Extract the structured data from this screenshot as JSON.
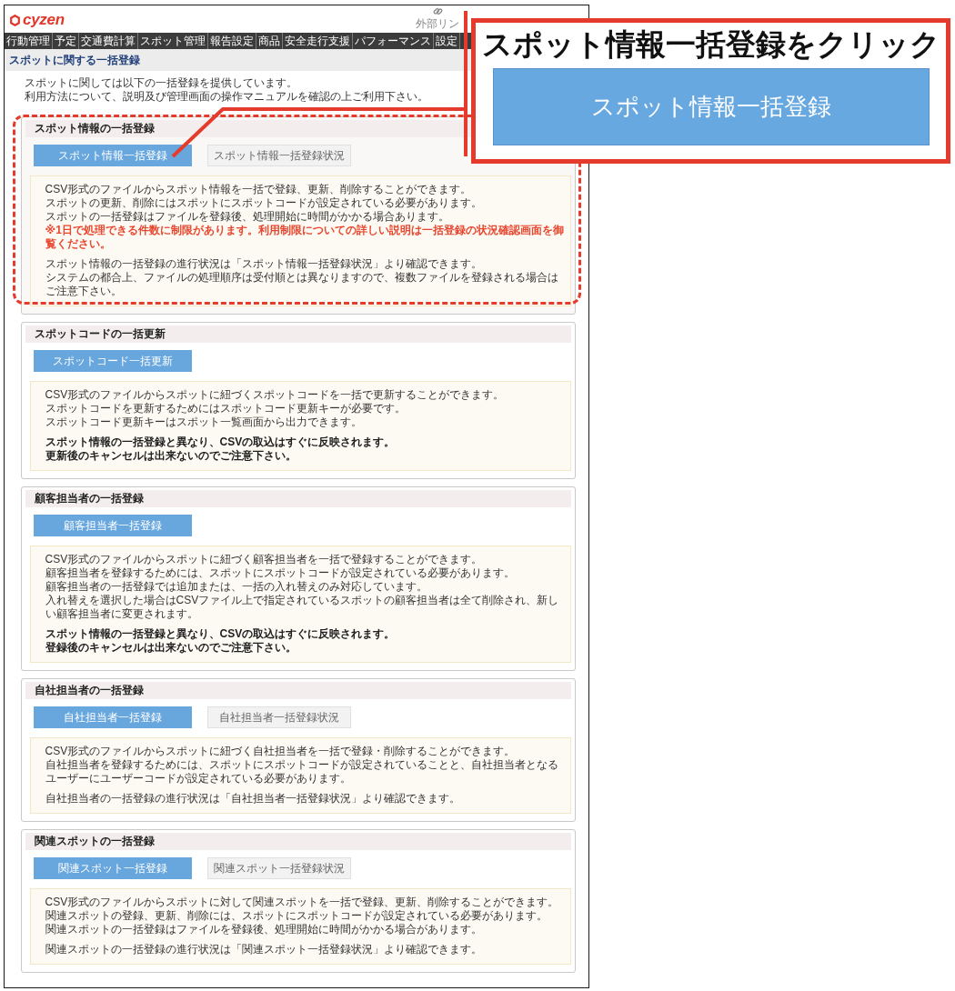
{
  "header": {
    "logo": "cyzen",
    "external_link": "外部リン"
  },
  "nav": [
    {
      "label": "行動管理"
    },
    {
      "label": "予定"
    },
    {
      "label": "交通費計算"
    },
    {
      "label": "スポット管理"
    },
    {
      "label": "報告設定"
    },
    {
      "label": "商品"
    },
    {
      "label": "安全走行支援"
    },
    {
      "label": "パフォーマンス"
    },
    {
      "label": "設定"
    }
  ],
  "page_title": "スポットに関する一括登録",
  "intro": [
    "スポットに関しては以下の一括登録を提供しています。",
    "利用方法について、説明及び管理画面の操作マニュアルを確認の上ご利用下さい。"
  ],
  "sections": [
    {
      "title": "スポット情報の一括登録",
      "highlighted": true,
      "buttons": [
        {
          "label": "スポット情報一括登録",
          "kind": "primary"
        },
        {
          "label": "スポット情報一括登録状況",
          "kind": "secondary"
        }
      ],
      "paragraphs": [
        {
          "lines": [
            {
              "text": "CSV形式のファイルからスポット情報を一括で登録、更新、削除することができます。",
              "kind": "normal"
            },
            {
              "text": "スポットの更新、削除にはスポットにスポットコードが設定されている必要があります。",
              "kind": "normal"
            },
            {
              "text": "スポットの一括登録はファイルを登録後、処理開始に時間がかかる場合あります。",
              "kind": "normal"
            },
            {
              "text": "※1日で処理できる件数に制限があります。利用制限についての詳しい説明は一括登録の状況確認画面を御覧ください。",
              "kind": "warning"
            }
          ]
        },
        {
          "lines": [
            {
              "text": "スポット情報の一括登録の進行状況は「スポット情報一括登録状況」より確認できます。",
              "kind": "normal"
            },
            {
              "text": "システムの都合上、ファイルの処理順序は受付順とは異なりますので、複数ファイルを登録される場合はご注意下さい。",
              "kind": "normal"
            }
          ]
        }
      ]
    },
    {
      "title": "スポットコードの一括更新",
      "highlighted": false,
      "buttons": [
        {
          "label": "スポットコード一括更新",
          "kind": "primary"
        }
      ],
      "paragraphs": [
        {
          "lines": [
            {
              "text": "CSV形式のファイルからスポットに紐づくスポットコードを一括で更新することができます。",
              "kind": "normal"
            },
            {
              "text": "スポットコードを更新するためにはスポットコード更新キーが必要です。",
              "kind": "normal"
            },
            {
              "text": "スポットコード更新キーはスポット一覧画面から出力できます。",
              "kind": "normal"
            }
          ]
        },
        {
          "lines": [
            {
              "text": "スポット情報の一括登録と異なり、CSVの取込はすぐに反映されます。",
              "kind": "bold"
            },
            {
              "text": "更新後のキャンセルは出来ないのでご注意下さい。",
              "kind": "bold"
            }
          ]
        }
      ]
    },
    {
      "title": "顧客担当者の一括登録",
      "highlighted": false,
      "buttons": [
        {
          "label": "顧客担当者一括登録",
          "kind": "primary"
        }
      ],
      "paragraphs": [
        {
          "lines": [
            {
              "text": "CSV形式のファイルからスポットに紐づく顧客担当者を一括で登録することができます。",
              "kind": "normal"
            },
            {
              "text": "顧客担当者を登録するためには、スポットにスポットコードが設定されている必要があります。",
              "kind": "normal"
            },
            {
              "text": "顧客担当者の一括登録では追加または、一括の入れ替えのみ対応しています。",
              "kind": "normal"
            },
            {
              "text": "入れ替えを選択した場合はCSVファイル上で指定されているスポットの顧客担当者は全て削除され、新しい顧客担当者に変更されます。",
              "kind": "normal"
            }
          ]
        },
        {
          "lines": [
            {
              "text": "スポット情報の一括登録と異なり、CSVの取込はすぐに反映されます。",
              "kind": "bold"
            },
            {
              "text": "登録後のキャンセルは出来ないのでご注意下さい。",
              "kind": "bold"
            }
          ]
        }
      ]
    },
    {
      "title": "自社担当者の一括登録",
      "highlighted": false,
      "buttons": [
        {
          "label": "自社担当者一括登録",
          "kind": "primary"
        },
        {
          "label": "自社担当者一括登録状況",
          "kind": "secondary"
        }
      ],
      "paragraphs": [
        {
          "lines": [
            {
              "text": "CSV形式のファイルからスポットに紐づく自社担当者を一括で登録・削除することができます。",
              "kind": "normal"
            },
            {
              "text": "自社担当者を登録するためには、スポットにスポットコードが設定されていることと、自社担当者となるユーザーにユーザーコードが設定されている必要があります。",
              "kind": "normal"
            }
          ]
        },
        {
          "lines": [
            {
              "text": "自社担当者の一括登録の進行状況は「自社担当者一括登録状況」より確認できます。",
              "kind": "normal"
            }
          ]
        }
      ]
    },
    {
      "title": "関連スポットの一括登録",
      "highlighted": false,
      "buttons": [
        {
          "label": "関連スポット一括登録",
          "kind": "primary"
        },
        {
          "label": "関連スポット一括登録状況",
          "kind": "secondary"
        }
      ],
      "paragraphs": [
        {
          "lines": [
            {
              "text": "CSV形式のファイルからスポットに対して関連スポットを一括で登録、更新、削除することができます。",
              "kind": "normal"
            },
            {
              "text": "関連スポットの登録、更新、削除には、スポットにスポットコードが設定されている必要があります。",
              "kind": "normal"
            },
            {
              "text": "関連スポットの一括登録はファイルを登録後、処理開始に時間がかかる場合があります。",
              "kind": "normal"
            }
          ]
        },
        {
          "lines": [
            {
              "text": "関連スポットの一括登録の進行状況は「関連スポット一括登録状況」より確認できます。",
              "kind": "normal"
            }
          ]
        }
      ]
    }
  ],
  "annotation": {
    "title": "スポット情報一括登録をクリック",
    "button_label": "スポット情報一括登録"
  }
}
